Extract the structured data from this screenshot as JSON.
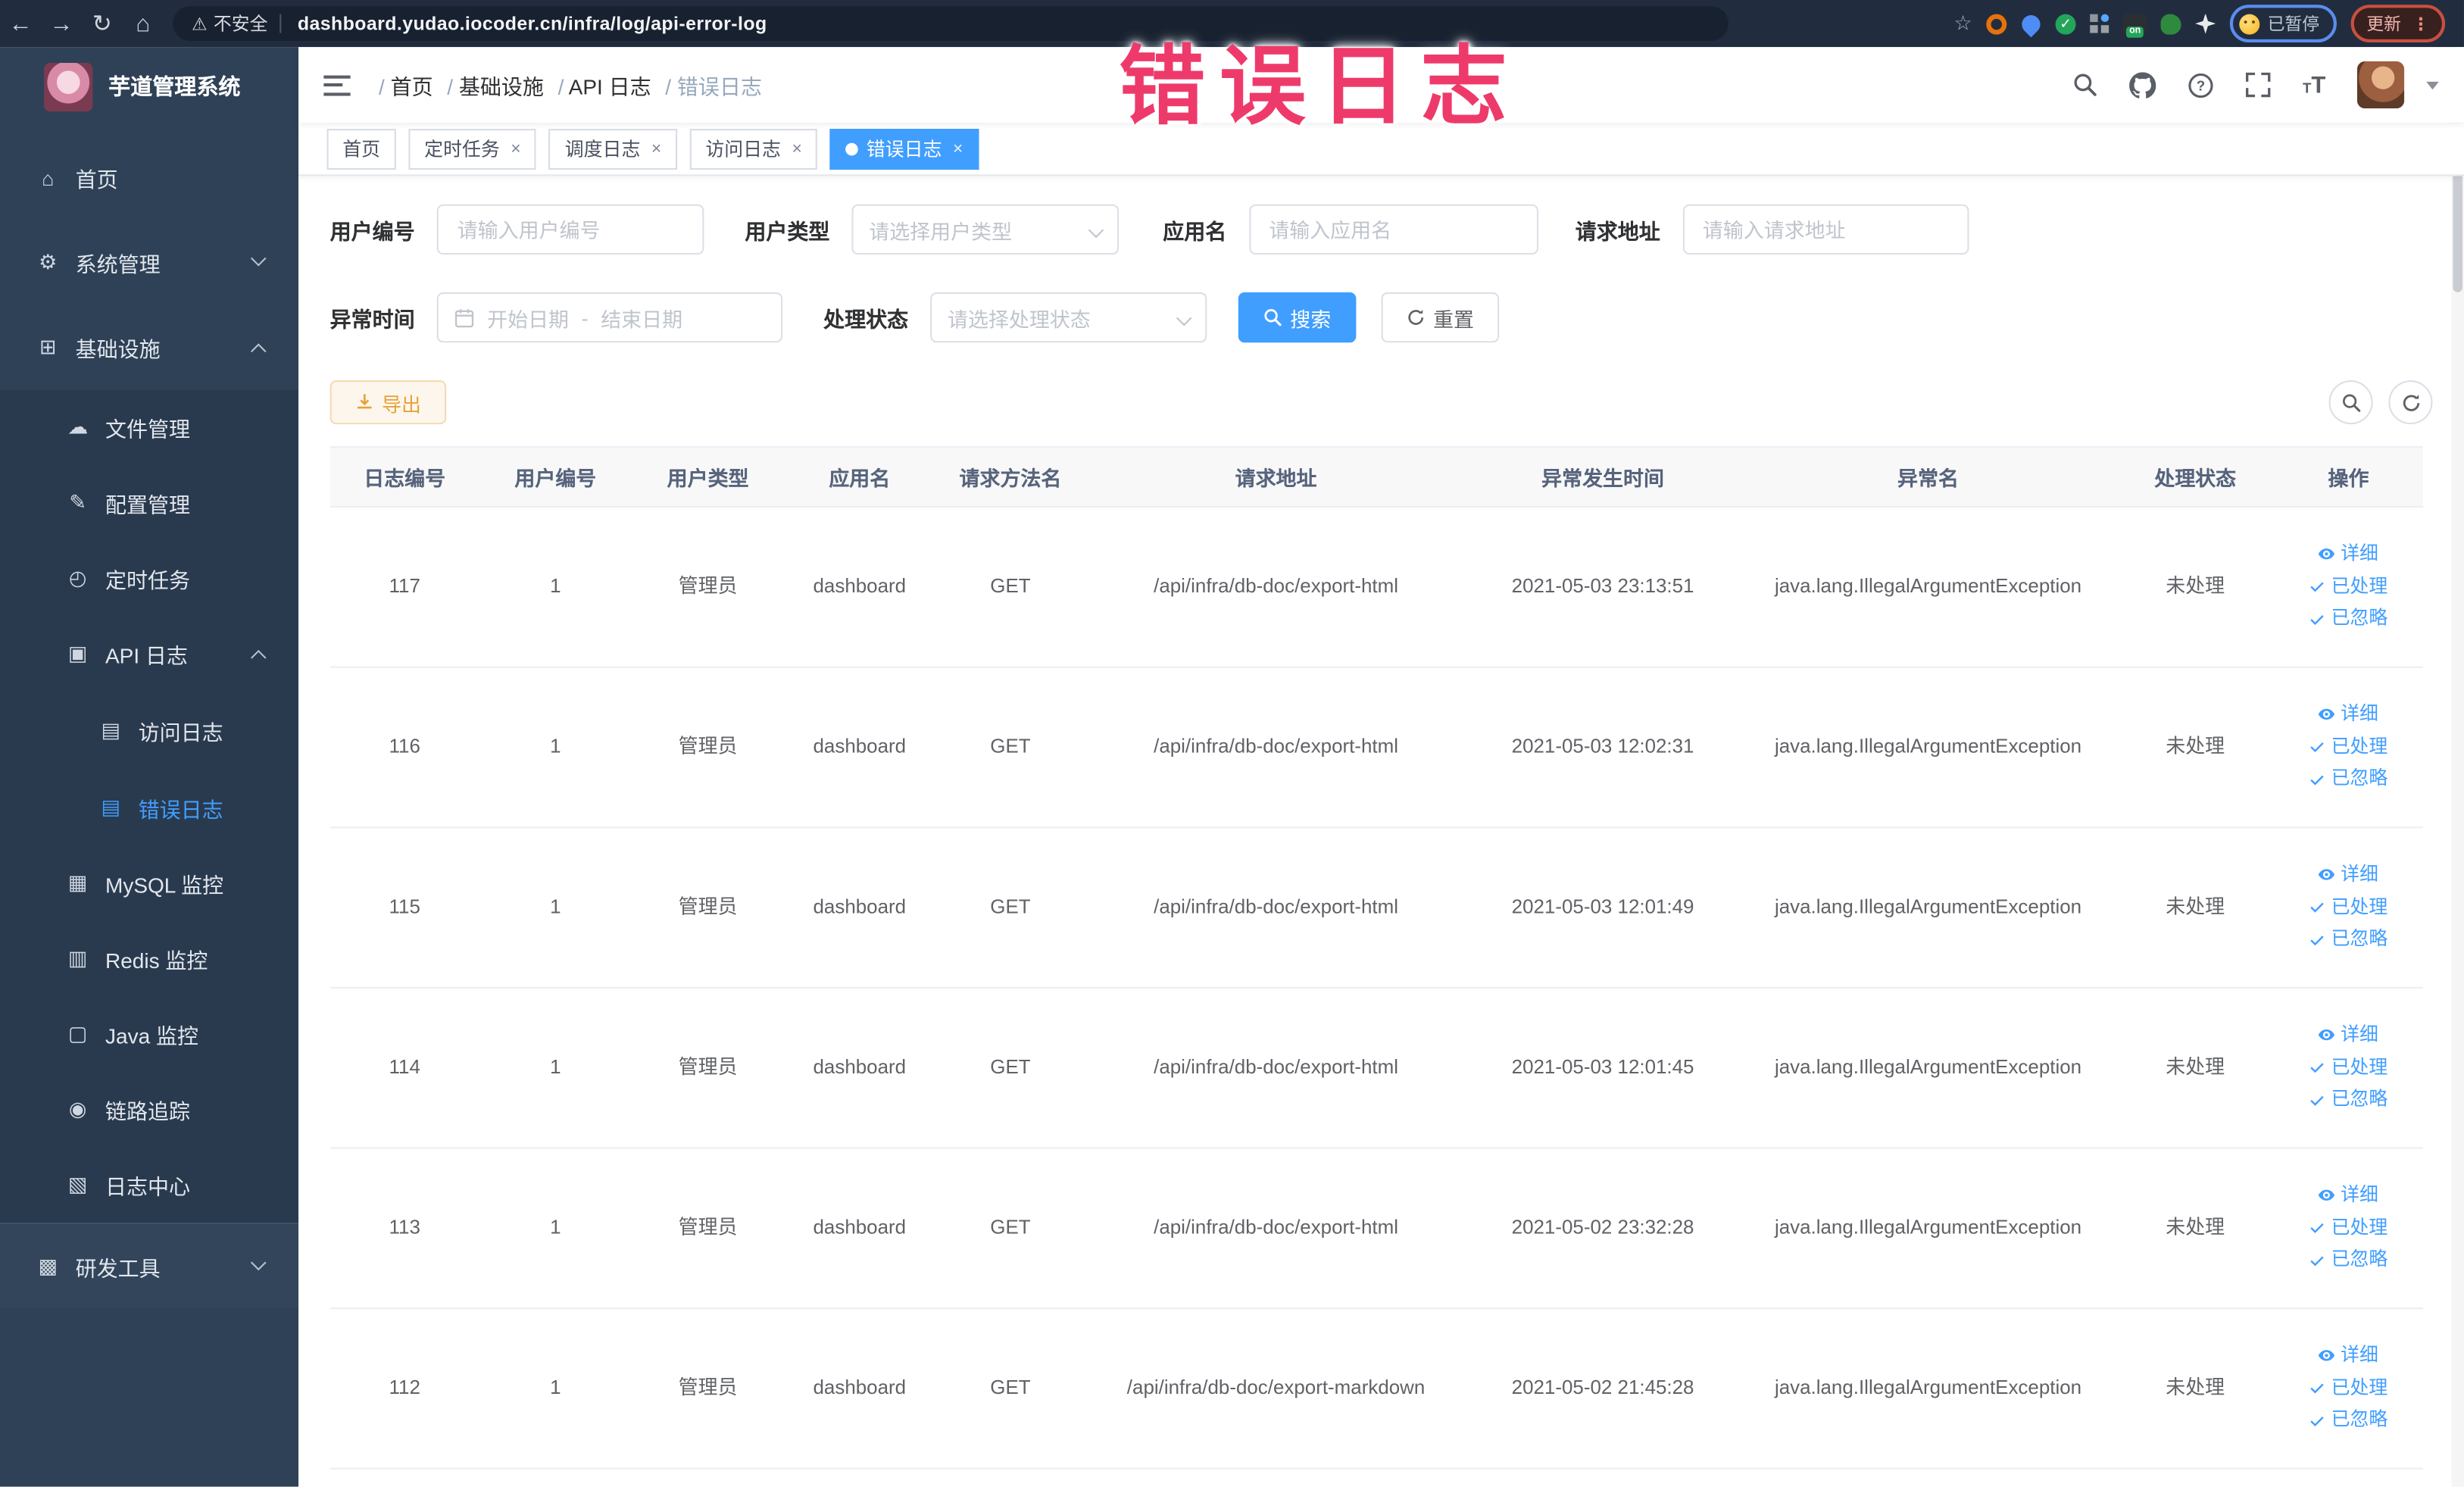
{
  "annotation": "错误日志",
  "browser": {
    "security_label": "不安全",
    "url": "dashboard.yudao.iocoder.cn/infra/log/api-error-log",
    "paused_badge": "已暂停",
    "update_badge": "更新"
  },
  "sidebar": {
    "app_title": "芋道管理系统",
    "items": [
      {
        "key": "home",
        "level": 0,
        "icon": "home",
        "glyph": "⌂",
        "label": "首页"
      },
      {
        "key": "system",
        "level": 0,
        "icon": "gear",
        "glyph": "⚙",
        "label": "系统管理",
        "arrow": "down"
      },
      {
        "key": "infra",
        "level": 0,
        "icon": "monitor",
        "glyph": "⊞",
        "label": "基础设施",
        "arrow": "up"
      },
      {
        "key": "file-mgmt",
        "level": 1,
        "icon": "cloud",
        "glyph": "☁",
        "label": "文件管理"
      },
      {
        "key": "config-mgmt",
        "level": 1,
        "icon": "edit",
        "glyph": "✎",
        "label": "配置管理"
      },
      {
        "key": "cron-job",
        "level": 1,
        "icon": "timer",
        "glyph": "◴",
        "label": "定时任务"
      },
      {
        "key": "api-log",
        "level": 1,
        "icon": "document",
        "glyph": "▣",
        "label": "API 日志",
        "arrow": "up"
      },
      {
        "key": "access-log",
        "level": 2,
        "icon": "document",
        "glyph": "▤",
        "label": "访问日志"
      },
      {
        "key": "error-log",
        "level": 2,
        "icon": "document",
        "glyph": "▤",
        "label": "错误日志",
        "active": true
      },
      {
        "key": "mysql-monitor",
        "level": 1,
        "icon": "database",
        "glyph": "▦",
        "label": "MySQL 监控"
      },
      {
        "key": "redis-monitor",
        "level": 1,
        "icon": "layers",
        "glyph": "▥",
        "label": "Redis 监控"
      },
      {
        "key": "java-monitor",
        "level": 1,
        "icon": "screen",
        "glyph": "▢",
        "label": "Java 监控"
      },
      {
        "key": "trace",
        "level": 1,
        "icon": "eye",
        "glyph": "◉",
        "label": "链路追踪"
      },
      {
        "key": "log-center",
        "level": 1,
        "icon": "document",
        "glyph": "▧",
        "label": "日志中心"
      },
      {
        "key": "dev-tools",
        "level": 0,
        "icon": "toolbox",
        "glyph": "▩",
        "label": "研发工具",
        "arrow": "down",
        "section": true
      }
    ]
  },
  "header": {
    "breadcrumb": [
      {
        "label": "首页"
      },
      {
        "label": "基础设施"
      },
      {
        "label": "API 日志"
      },
      {
        "label": "错误日志"
      }
    ]
  },
  "tabs": [
    {
      "key": "home",
      "label": "首页"
    },
    {
      "key": "cron-job",
      "label": "定时任务",
      "closable": true
    },
    {
      "key": "job-log",
      "label": "调度日志",
      "closable": true
    },
    {
      "key": "access-log",
      "label": "访问日志",
      "closable": true
    },
    {
      "key": "error-log",
      "label": "错误日志",
      "closable": true,
      "active": true
    }
  ],
  "filters": {
    "user_id": {
      "label": "用户编号",
      "placeholder": "请输入用户编号"
    },
    "user_type": {
      "label": "用户类型",
      "placeholder": "请选择用户类型"
    },
    "app_name": {
      "label": "应用名",
      "placeholder": "请输入应用名"
    },
    "request_url": {
      "label": "请求地址",
      "placeholder": "请输入请求地址"
    },
    "exception_time": {
      "label": "异常时间",
      "start_placeholder": "开始日期",
      "separator": "-",
      "end_placeholder": "结束日期"
    },
    "process_status": {
      "label": "处理状态",
      "placeholder": "请选择处理状态"
    },
    "search_label": "搜索",
    "reset_label": "重置"
  },
  "toolbar": {
    "export_label": "导出"
  },
  "table": {
    "columns": [
      "日志编号",
      "用户编号",
      "用户类型",
      "应用名",
      "请求方法名",
      "请求地址",
      "异常发生时间",
      "异常名",
      "处理状态",
      "操作"
    ],
    "actions": [
      "详细",
      "已处理",
      "已忽略"
    ],
    "rows": [
      {
        "id": "117",
        "user_id": "1",
        "user_type": "管理员",
        "app": "dashboard",
        "method": "GET",
        "url": "/api/infra/db-doc/export-html",
        "time": "2021-05-03 23:13:51",
        "exception": "java.lang.IllegalArgumentException",
        "status": "未处理"
      },
      {
        "id": "116",
        "user_id": "1",
        "user_type": "管理员",
        "app": "dashboard",
        "method": "GET",
        "url": "/api/infra/db-doc/export-html",
        "time": "2021-05-03 12:02:31",
        "exception": "java.lang.IllegalArgumentException",
        "status": "未处理"
      },
      {
        "id": "115",
        "user_id": "1",
        "user_type": "管理员",
        "app": "dashboard",
        "method": "GET",
        "url": "/api/infra/db-doc/export-html",
        "time": "2021-05-03 12:01:49",
        "exception": "java.lang.IllegalArgumentException",
        "status": "未处理"
      },
      {
        "id": "114",
        "user_id": "1",
        "user_type": "管理员",
        "app": "dashboard",
        "method": "GET",
        "url": "/api/infra/db-doc/export-html",
        "time": "2021-05-03 12:01:45",
        "exception": "java.lang.IllegalArgumentException",
        "status": "未处理"
      },
      {
        "id": "113",
        "user_id": "1",
        "user_type": "管理员",
        "app": "dashboard",
        "method": "GET",
        "url": "/api/infra/db-doc/export-html",
        "time": "2021-05-02 23:32:28",
        "exception": "java.lang.IllegalArgumentException",
        "status": "未处理"
      },
      {
        "id": "112",
        "user_id": "1",
        "user_type": "管理员",
        "app": "dashboard",
        "method": "GET",
        "url": "/api/infra/db-doc/export-markdown",
        "time": "2021-05-02 21:45:28",
        "exception": "java.lang.IllegalArgumentException",
        "status": "未处理"
      }
    ]
  }
}
